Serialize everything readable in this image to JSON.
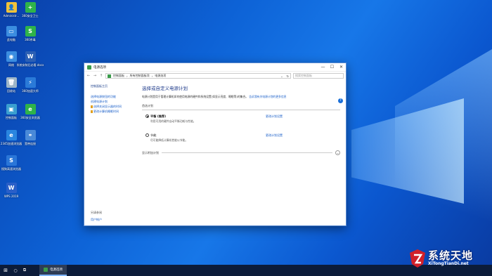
{
  "desktop": {
    "icons": [
      {
        "label": "Administr...",
        "color": "#f0c23a",
        "glyph": "👤"
      },
      {
        "label": "360安全卫士",
        "color": "#2fb34a",
        "glyph": "+"
      },
      {
        "label": "此电脑",
        "color": "#3b8de0",
        "glyph": "▭"
      },
      {
        "label": "360杀毒",
        "color": "#2fb34a",
        "glyph": "S"
      },
      {
        "label": "网络",
        "color": "#3b8de0",
        "glyph": "◉"
      },
      {
        "label": "系统安装后必看.docx",
        "color": "#2b5fb4",
        "glyph": "W"
      },
      {
        "label": "回收站",
        "color": "#9fb6c8",
        "glyph": "🗑"
      },
      {
        "label": "360加速大师",
        "color": "#2a7ad8",
        "glyph": "⚡"
      },
      {
        "label": "控制面板",
        "color": "#3a9fd0",
        "glyph": "▣"
      },
      {
        "label": "360安全浏览器",
        "color": "#2fb34a",
        "glyph": "e"
      },
      {
        "label": "2345加速浏览器",
        "color": "#2a86e0",
        "glyph": "e"
      },
      {
        "label": "宽带连接",
        "color": "#4a8ad8",
        "glyph": "⚭"
      },
      {
        "label": "搜狗高速浏览器",
        "color": "#2a76d8",
        "glyph": "S"
      },
      {
        "label": "WPS 2019",
        "color": "#2a5fc8",
        "glyph": "W"
      }
    ]
  },
  "window": {
    "title": "电源选项",
    "controls": {
      "minimize": "—",
      "maximize": "☐",
      "close": "✕"
    },
    "breadcrumb": [
      "控制面板",
      "所有控制面板项",
      "电源选项"
    ],
    "search_placeholder": "搜索控制面板",
    "nav": {
      "back": "←",
      "forward": "→",
      "up": "↑",
      "dropdown": "⌄",
      "refresh": "↻"
    },
    "sidebar": {
      "home": "控制面板主页",
      "links": [
        "选择电源按钮的功能",
        "创建电源计划",
        "选择关闭显示器的时间",
        "更改计算机睡眠时间"
      ],
      "see_also": "另请参阅",
      "user_accounts": "用户帐户"
    },
    "main": {
      "heading": "选择或自定义电源计划",
      "description": "电源计划是用于管理计算机如何使用电源的硬件和系统设置(如显示亮度、睡眠等)的集合。",
      "more_link": "告诉我有关电源计划的更多信息",
      "group_label": "首选计划",
      "plans": [
        {
          "name": "平衡 (推荐)",
          "desc": "利用可用的硬件自动平衡功耗与性能。",
          "change": "更改计划设置",
          "selected": true
        },
        {
          "name": "节能",
          "desc": "尽可能降低计算机性能以节能。",
          "change": "更改计划设置",
          "selected": false
        }
      ],
      "show_more": "显示附加计划",
      "expand_icon": "⌄",
      "help": "?"
    }
  },
  "taskbar": {
    "start_icon": "⊞",
    "search_icon": "○",
    "taskview_icon": "⧉",
    "app_label": "电源选项"
  },
  "watermark": {
    "line1": "系统天地",
    "line2": "XiTongTianDi.net"
  },
  "colors": {
    "accent": "#1a5fc8",
    "heading": "#1e3a8a",
    "desktop": "#0d62d6"
  }
}
